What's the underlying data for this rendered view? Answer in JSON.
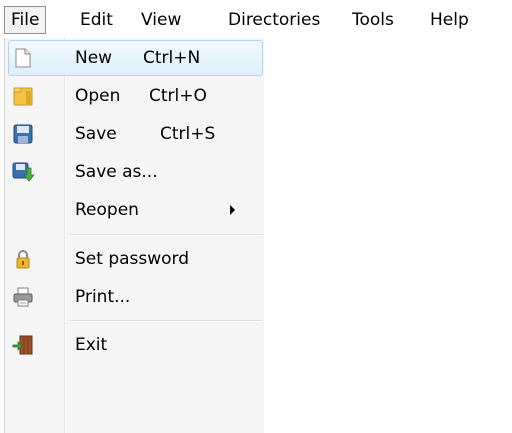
{
  "menubar": {
    "items": [
      {
        "label": "File"
      },
      {
        "label": "Edit"
      },
      {
        "label": "View"
      },
      {
        "label": "Directories"
      },
      {
        "label": "Tools"
      },
      {
        "label": "Help"
      }
    ]
  },
  "file_menu": {
    "items": [
      {
        "label": "New",
        "shortcut": "Ctrl+N",
        "icon": "new-document-icon"
      },
      {
        "label": "Open",
        "shortcut": "Ctrl+O",
        "icon": "folder-open-icon"
      },
      {
        "label": "Save",
        "shortcut": "Ctrl+S",
        "icon": "floppy-disk-icon"
      },
      {
        "label": "Save as...",
        "icon": "save-as-icon"
      },
      {
        "label": "Reopen",
        "submenu": true
      },
      {
        "label": "Set password",
        "icon": "padlock-icon"
      },
      {
        "label": "Print...",
        "icon": "printer-icon"
      },
      {
        "label": "Exit",
        "icon": "exit-door-icon"
      }
    ]
  },
  "colors": {
    "hover_border": "#a8d8f0",
    "menu_background": "#f5f5f5"
  }
}
